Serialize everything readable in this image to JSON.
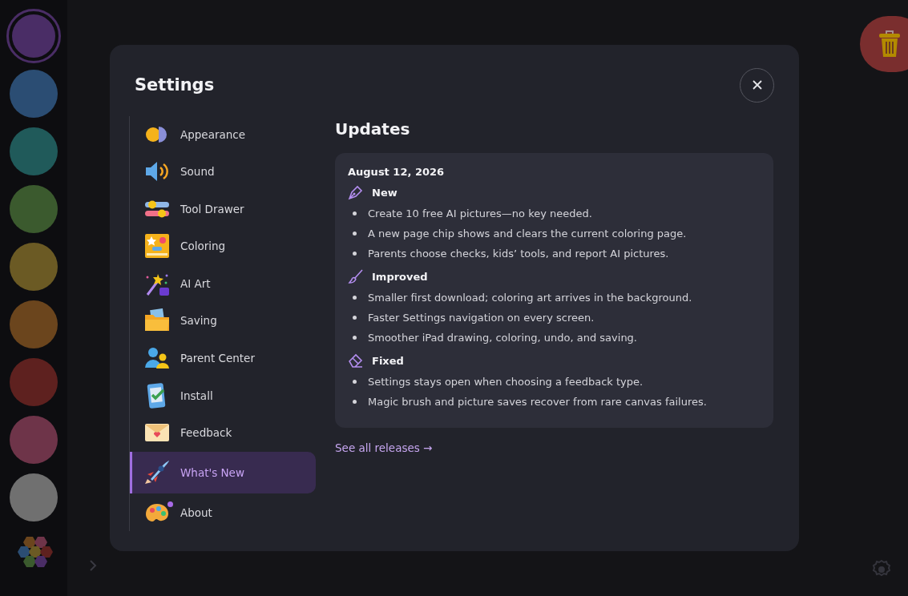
{
  "palette": [
    {
      "color": "#4a2d66",
      "selected": true
    },
    {
      "color": "#2b4d73",
      "selected": false
    },
    {
      "color": "#205a5a",
      "selected": false
    },
    {
      "color": "#3b5a2e",
      "selected": false
    },
    {
      "color": "#6b5a24",
      "selected": false
    },
    {
      "color": "#6b451d",
      "selected": false
    },
    {
      "color": "#5e211f",
      "selected": false
    },
    {
      "color": "#6e3449",
      "selected": false
    },
    {
      "color": "#707070",
      "selected": false
    }
  ],
  "dialog": {
    "title": "Settings",
    "nav": [
      {
        "label": "Appearance",
        "selected": false,
        "unread": false
      },
      {
        "label": "Sound",
        "selected": false,
        "unread": false
      },
      {
        "label": "Tool Drawer",
        "selected": false,
        "unread": false
      },
      {
        "label": "Coloring",
        "selected": false,
        "unread": false
      },
      {
        "label": "AI Art",
        "selected": false,
        "unread": false
      },
      {
        "label": "Saving",
        "selected": false,
        "unread": false
      },
      {
        "label": "Parent Center",
        "selected": false,
        "unread": false
      },
      {
        "label": "Install",
        "selected": false,
        "unread": false
      },
      {
        "label": "Feedback",
        "selected": false,
        "unread": false
      },
      {
        "label": "What's New",
        "selected": true,
        "unread": false
      },
      {
        "label": "About",
        "selected": false,
        "unread": true
      }
    ],
    "heading": "Updates",
    "release": {
      "date": "August 12, 2026",
      "sections": [
        {
          "title": "New",
          "items": [
            "Create 10 free AI pictures—no key needed.",
            "A new page chip shows and clears the current coloring page.",
            "Parents choose checks, kids’ tools, and report AI pictures."
          ]
        },
        {
          "title": "Improved",
          "items": [
            "Smaller first download; coloring art arrives in the background.",
            "Faster Settings navigation on every screen.",
            "Smoother iPad drawing, coloring, undo, and saving."
          ]
        },
        {
          "title": "Fixed",
          "items": [
            "Settings stays open when choosing a feedback type.",
            "Magic brush and picture saves recover from rare canvas failures."
          ]
        }
      ]
    },
    "link": "See all releases →"
  }
}
